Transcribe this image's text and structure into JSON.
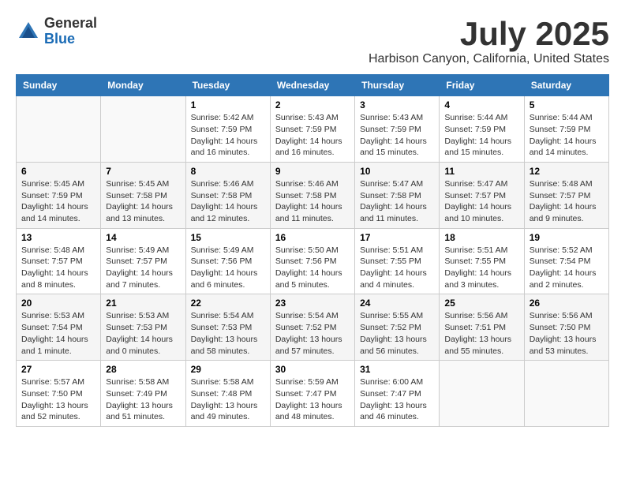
{
  "header": {
    "logo_general": "General",
    "logo_blue": "Blue",
    "month_title": "July 2025",
    "location": "Harbison Canyon, California, United States"
  },
  "weekdays": [
    "Sunday",
    "Monday",
    "Tuesday",
    "Wednesday",
    "Thursday",
    "Friday",
    "Saturday"
  ],
  "weeks": [
    [
      {
        "day": "",
        "info": ""
      },
      {
        "day": "",
        "info": ""
      },
      {
        "day": "1",
        "info": "Sunrise: 5:42 AM\nSunset: 7:59 PM\nDaylight: 14 hours\nand 16 minutes."
      },
      {
        "day": "2",
        "info": "Sunrise: 5:43 AM\nSunset: 7:59 PM\nDaylight: 14 hours\nand 16 minutes."
      },
      {
        "day": "3",
        "info": "Sunrise: 5:43 AM\nSunset: 7:59 PM\nDaylight: 14 hours\nand 15 minutes."
      },
      {
        "day": "4",
        "info": "Sunrise: 5:44 AM\nSunset: 7:59 PM\nDaylight: 14 hours\nand 15 minutes."
      },
      {
        "day": "5",
        "info": "Sunrise: 5:44 AM\nSunset: 7:59 PM\nDaylight: 14 hours\nand 14 minutes."
      }
    ],
    [
      {
        "day": "6",
        "info": "Sunrise: 5:45 AM\nSunset: 7:59 PM\nDaylight: 14 hours\nand 14 minutes."
      },
      {
        "day": "7",
        "info": "Sunrise: 5:45 AM\nSunset: 7:58 PM\nDaylight: 14 hours\nand 13 minutes."
      },
      {
        "day": "8",
        "info": "Sunrise: 5:46 AM\nSunset: 7:58 PM\nDaylight: 14 hours\nand 12 minutes."
      },
      {
        "day": "9",
        "info": "Sunrise: 5:46 AM\nSunset: 7:58 PM\nDaylight: 14 hours\nand 11 minutes."
      },
      {
        "day": "10",
        "info": "Sunrise: 5:47 AM\nSunset: 7:58 PM\nDaylight: 14 hours\nand 11 minutes."
      },
      {
        "day": "11",
        "info": "Sunrise: 5:47 AM\nSunset: 7:57 PM\nDaylight: 14 hours\nand 10 minutes."
      },
      {
        "day": "12",
        "info": "Sunrise: 5:48 AM\nSunset: 7:57 PM\nDaylight: 14 hours\nand 9 minutes."
      }
    ],
    [
      {
        "day": "13",
        "info": "Sunrise: 5:48 AM\nSunset: 7:57 PM\nDaylight: 14 hours\nand 8 minutes."
      },
      {
        "day": "14",
        "info": "Sunrise: 5:49 AM\nSunset: 7:57 PM\nDaylight: 14 hours\nand 7 minutes."
      },
      {
        "day": "15",
        "info": "Sunrise: 5:49 AM\nSunset: 7:56 PM\nDaylight: 14 hours\nand 6 minutes."
      },
      {
        "day": "16",
        "info": "Sunrise: 5:50 AM\nSunset: 7:56 PM\nDaylight: 14 hours\nand 5 minutes."
      },
      {
        "day": "17",
        "info": "Sunrise: 5:51 AM\nSunset: 7:55 PM\nDaylight: 14 hours\nand 4 minutes."
      },
      {
        "day": "18",
        "info": "Sunrise: 5:51 AM\nSunset: 7:55 PM\nDaylight: 14 hours\nand 3 minutes."
      },
      {
        "day": "19",
        "info": "Sunrise: 5:52 AM\nSunset: 7:54 PM\nDaylight: 14 hours\nand 2 minutes."
      }
    ],
    [
      {
        "day": "20",
        "info": "Sunrise: 5:53 AM\nSunset: 7:54 PM\nDaylight: 14 hours\nand 1 minute."
      },
      {
        "day": "21",
        "info": "Sunrise: 5:53 AM\nSunset: 7:53 PM\nDaylight: 14 hours\nand 0 minutes."
      },
      {
        "day": "22",
        "info": "Sunrise: 5:54 AM\nSunset: 7:53 PM\nDaylight: 13 hours\nand 58 minutes."
      },
      {
        "day": "23",
        "info": "Sunrise: 5:54 AM\nSunset: 7:52 PM\nDaylight: 13 hours\nand 57 minutes."
      },
      {
        "day": "24",
        "info": "Sunrise: 5:55 AM\nSunset: 7:52 PM\nDaylight: 13 hours\nand 56 minutes."
      },
      {
        "day": "25",
        "info": "Sunrise: 5:56 AM\nSunset: 7:51 PM\nDaylight: 13 hours\nand 55 minutes."
      },
      {
        "day": "26",
        "info": "Sunrise: 5:56 AM\nSunset: 7:50 PM\nDaylight: 13 hours\nand 53 minutes."
      }
    ],
    [
      {
        "day": "27",
        "info": "Sunrise: 5:57 AM\nSunset: 7:50 PM\nDaylight: 13 hours\nand 52 minutes."
      },
      {
        "day": "28",
        "info": "Sunrise: 5:58 AM\nSunset: 7:49 PM\nDaylight: 13 hours\nand 51 minutes."
      },
      {
        "day": "29",
        "info": "Sunrise: 5:58 AM\nSunset: 7:48 PM\nDaylight: 13 hours\nand 49 minutes."
      },
      {
        "day": "30",
        "info": "Sunrise: 5:59 AM\nSunset: 7:47 PM\nDaylight: 13 hours\nand 48 minutes."
      },
      {
        "day": "31",
        "info": "Sunrise: 6:00 AM\nSunset: 7:47 PM\nDaylight: 13 hours\nand 46 minutes."
      },
      {
        "day": "",
        "info": ""
      },
      {
        "day": "",
        "info": ""
      }
    ]
  ]
}
